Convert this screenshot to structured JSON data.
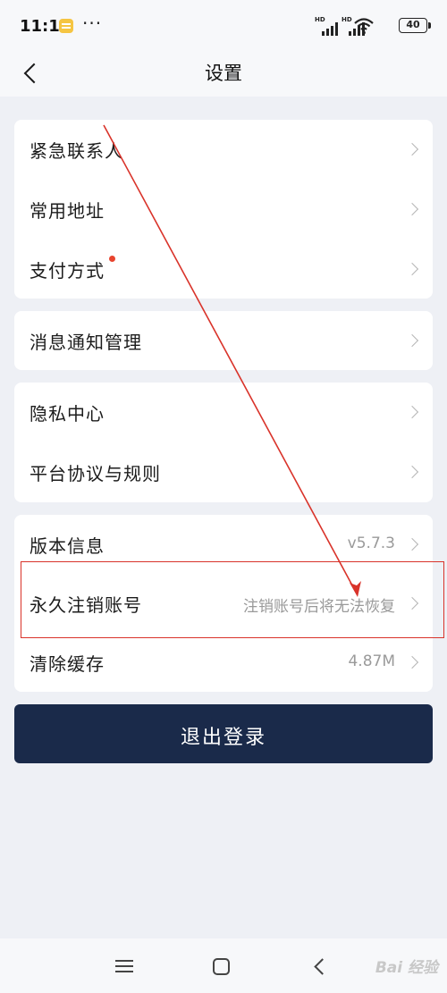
{
  "status_bar": {
    "time": "11:19",
    "dots": "···",
    "network_label_1": "HD",
    "network_label_2": "HD",
    "battery": "40"
  },
  "nav": {
    "title": "设置"
  },
  "groups": [
    {
      "items": [
        {
          "label": "紧急联系人",
          "value": ""
        },
        {
          "label": "常用地址",
          "value": ""
        },
        {
          "label": "支付方式",
          "value": "",
          "badge": true
        }
      ]
    },
    {
      "items": [
        {
          "label": "消息通知管理",
          "value": ""
        }
      ]
    },
    {
      "items": [
        {
          "label": "隐私中心",
          "value": ""
        },
        {
          "label": "平台协议与规则",
          "value": ""
        }
      ]
    },
    {
      "items": [
        {
          "label": "版本信息",
          "value": "v5.7.3"
        },
        {
          "label": "永久注销账号",
          "value": "注销账号后将无法恢复"
        },
        {
          "label": "清除缓存",
          "value": "4.87M"
        }
      ]
    }
  ],
  "logout_label": "退出登录",
  "watermark": "Bai 经验",
  "colors": {
    "background": "#eef0f5",
    "logout_button": "#1a2a4a",
    "annotation": "#d9332a",
    "badge": "#e8442e"
  }
}
